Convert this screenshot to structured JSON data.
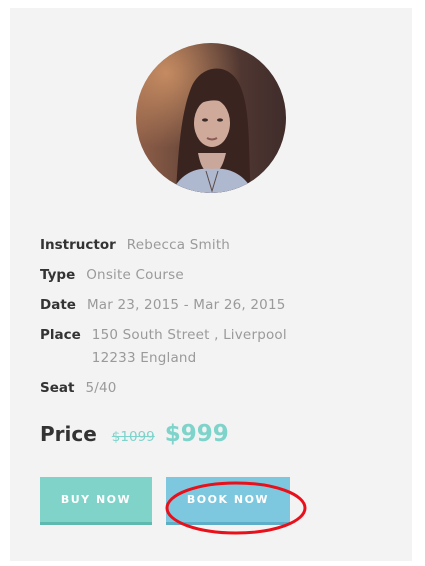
{
  "course_card": {
    "instructor": {
      "label": "Instructor",
      "value": "Rebecca Smith"
    },
    "type": {
      "label": "Type",
      "value": "Onsite Course"
    },
    "date": {
      "label": "Date",
      "value": "Mar 23, 2015 - Mar 26, 2015"
    },
    "place": {
      "label": "Place",
      "value": "150 South Street , Liverpool 12233 England"
    },
    "seat": {
      "label": "Seat",
      "value": "5/40"
    },
    "price": {
      "label": "Price",
      "old_value": "$1099",
      "new_value": "$999"
    },
    "buttons": {
      "buy_now": "BUY NOW",
      "book_now": "BOOK NOW"
    },
    "colors": {
      "card_background": "#f3f3f3",
      "accent_teal": "#7ed3cb",
      "buy_button": "#7fd3c9",
      "book_button": "#7ec8df",
      "annotation_circle": "#e8101a"
    }
  }
}
